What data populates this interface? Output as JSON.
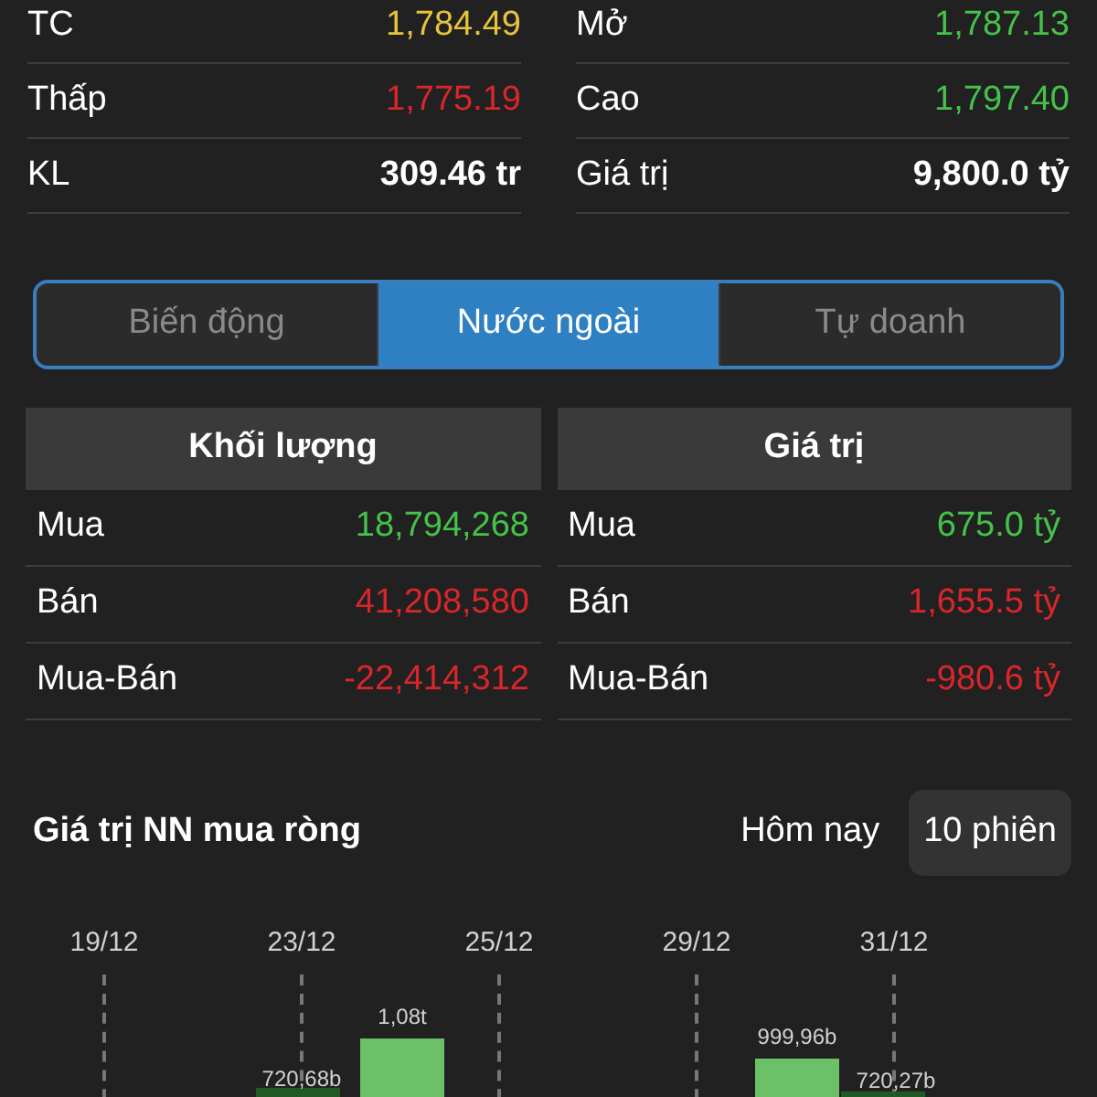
{
  "stats": [
    {
      "left": {
        "label": "TC",
        "value": "1,784.49",
        "color": "#e6c43c"
      },
      "right": {
        "label": "Mở",
        "value": "1,787.13",
        "color": "#45c24a"
      }
    },
    {
      "left": {
        "label": "Thấp",
        "value": "1,775.19",
        "color": "#d9262b"
      },
      "right": {
        "label": "Cao",
        "value": "1,797.40",
        "color": "#45c24a"
      }
    },
    {
      "left": {
        "label": "KL",
        "value": "309.46 tr",
        "color": "#ffffff"
      },
      "right": {
        "label": "Giá trị",
        "value": "9,800.0 tỷ",
        "color": "#ffffff"
      }
    }
  ],
  "tabs": [
    {
      "label": "Biến động",
      "selected": false
    },
    {
      "label": "Nước ngoài",
      "selected": true
    },
    {
      "label": "Tự doanh",
      "selected": false
    }
  ],
  "panels": [
    {
      "title": "Khối lượng",
      "rows": [
        {
          "label": "Mua",
          "value": "18,794,268",
          "color": "#45c24a"
        },
        {
          "label": "Bán",
          "value": "41,208,580",
          "color": "#d9262b"
        },
        {
          "label": "Mua-Bán",
          "value": "-22,414,312",
          "color": "#d9262b"
        }
      ]
    },
    {
      "title": "Giá trị",
      "rows": [
        {
          "label": "Mua",
          "value": "675.0 tỷ",
          "color": "#45c24a"
        },
        {
          "label": "Bán",
          "value": "1,655.5 tỷ",
          "color": "#d9262b"
        },
        {
          "label": "Mua-Bán",
          "value": "-980.6 tỷ",
          "color": "#d9262b"
        }
      ]
    }
  ],
  "section": {
    "title": "Giá trị NN mua ròng",
    "periods": [
      {
        "label": "Hôm nay",
        "selected": false
      },
      {
        "label": "10 phiên",
        "selected": true
      }
    ]
  },
  "chart": {
    "dates": [
      "19/12",
      "23/12",
      "25/12",
      "29/12",
      "31/12"
    ],
    "bar_labels": [
      "720,68b",
      "1,08t",
      "999,96b",
      "720,27b"
    ]
  }
}
